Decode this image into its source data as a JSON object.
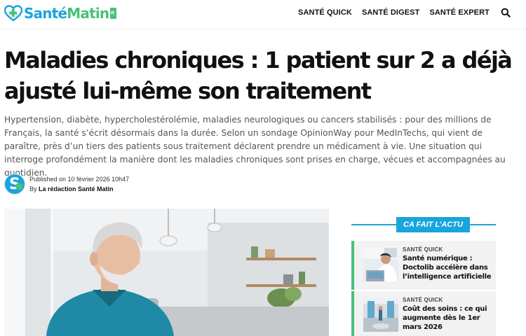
{
  "header": {
    "logo": {
      "part1": "Santé",
      "part2": "Matin",
      "tld": ".fr"
    },
    "nav": [
      {
        "label": "SANTÉ QUICK"
      },
      {
        "label": "SANTÉ DIGEST"
      },
      {
        "label": "SANTÉ EXPERT"
      }
    ],
    "search_icon": "search-icon"
  },
  "article": {
    "title": "Maladies chroniques : 1 patient sur 2 a déjà ajusté lui-même son traitement",
    "lede": "Hypertension, diabète, hypercholestérolémie, maladies neurologiques ou cancers stabilisés : pour des millions de Français, la santé s’écrit désormais dans la durée. Selon un sondage OpinionWay pour MedInTechs, qui vient de paraître, près d’un tiers des patients sous traitement déclarent prendre un médicament à vie. Une situation qui interroge profondément la manière dont les maladies chroniques sont prises en charge, vécues et accompagnées au quotidien.",
    "published": "Published on 10 février 2026 10h47",
    "by_prefix": "By",
    "author": "La rédaction Santé Matin"
  },
  "sidebar": {
    "widget_title": "CA FAIT L’ACTU",
    "cards": [
      {
        "category": "SANTÉ QUICK",
        "title": "Santé numérique : Doctolib accélère dans l’intelligence artificielle"
      },
      {
        "category": "SANTÉ QUICK",
        "title": "Coût des soins : ce qui augmente dès le 1er mars 2026"
      }
    ]
  },
  "colors": {
    "brand_blue": "#1aa4dc",
    "brand_green": "#48c17a",
    "text": "#111111",
    "lede": "#555555"
  }
}
